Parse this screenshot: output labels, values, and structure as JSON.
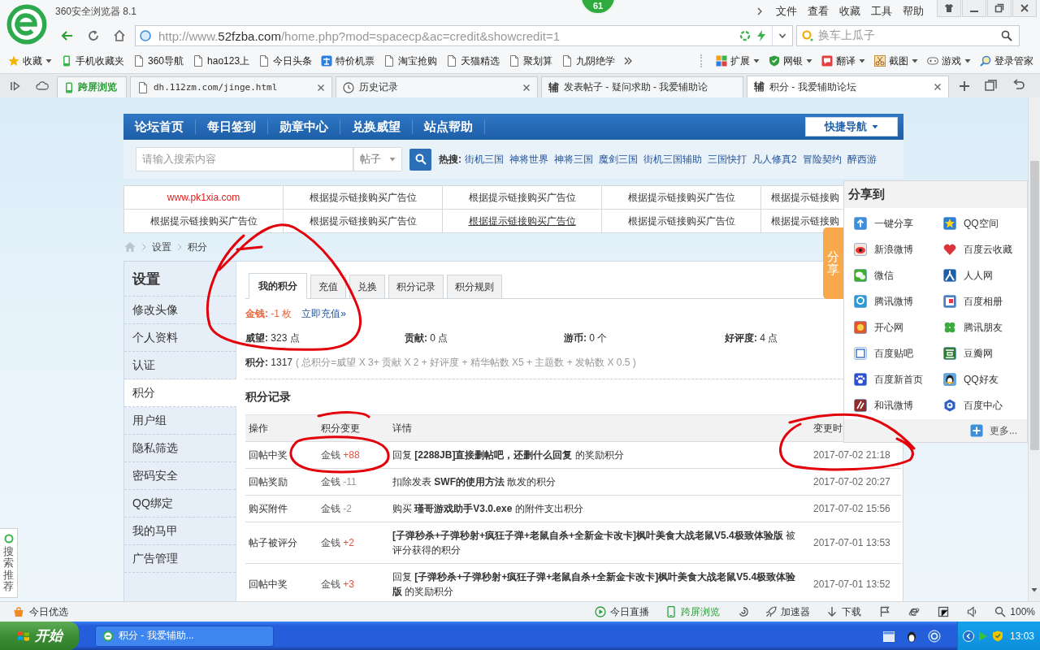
{
  "window": {
    "title": "360安全浏览器 8.1",
    "badge": "61",
    "menu": [
      "文件",
      "查看",
      "收藏",
      "工具",
      "帮助"
    ]
  },
  "address_bar": {
    "url_start": "http://www.",
    "url_domain": "52fzba.com",
    "url_rest": "/home.php?mod=spacecp&ac=credit&showcredit=1"
  },
  "search_box": {
    "placeholder": "换车上瓜子"
  },
  "bookmarks": [
    {
      "label": "收藏",
      "kind": "star",
      "dropdown": true
    },
    {
      "label": "手机收藏夹",
      "kind": "phone",
      "dropdown": false
    },
    {
      "label": "360导航",
      "kind": "page",
      "dropdown": false
    },
    {
      "label": "hao123上",
      "kind": "page",
      "dropdown": false
    },
    {
      "label": "今日头条",
      "kind": "page",
      "dropdown": false
    },
    {
      "label": "特价机票",
      "kind": "ticket",
      "dropdown": false
    },
    {
      "label": "淘宝抢购",
      "kind": "page",
      "dropdown": false
    },
    {
      "label": "天猫精选",
      "kind": "page",
      "dropdown": false
    },
    {
      "label": "聚划算",
      "kind": "page",
      "dropdown": false
    },
    {
      "label": "九阴绝学",
      "kind": "page",
      "dropdown": false
    }
  ],
  "toolbar_items": [
    {
      "label": "扩展",
      "kind": "grid",
      "dropdown": true
    },
    {
      "label": "网银",
      "kind": "shield",
      "dropdown": true
    },
    {
      "label": "翻译",
      "kind": "translate",
      "dropdown": true
    },
    {
      "label": "截图",
      "kind": "scissors",
      "dropdown": true
    },
    {
      "label": "游戏",
      "kind": "gamepad",
      "dropdown": true
    },
    {
      "label": "登录管家",
      "kind": "key",
      "dropdown": false
    }
  ],
  "tabs": [
    {
      "label": "跨屏浏览",
      "kind": "phone",
      "selected": false,
      "closable": false
    },
    {
      "label": "dh.112zm.com/jinge.html",
      "kind": "page",
      "selected": false,
      "closable": true
    },
    {
      "label": "历史记录",
      "kind": "clock",
      "selected": false,
      "closable": true
    },
    {
      "label": "发表帖子 - 疑问求助 - 我爱辅助论",
      "kind": "site",
      "favicon": "辅",
      "selected": false,
      "closable": false
    },
    {
      "label": "积分 - 我爱辅助论坛",
      "kind": "site",
      "favicon": "辅",
      "selected": true,
      "closable": true
    }
  ],
  "nav": {
    "items": [
      "论坛首页",
      "每日签到",
      "勋章中心",
      "兑换威望",
      "站点帮助"
    ],
    "quick_nav": "快捷导航"
  },
  "forum_search": {
    "placeholder": "请输入搜索内容",
    "scope": "帖子",
    "hot_label": "热搜:",
    "hot": [
      "街机三国",
      "神将世界",
      "神将三国",
      "魔剑三国",
      "街机三国辅助",
      "三国快打",
      "凡人修真2",
      "冒险契约",
      "醉西游"
    ]
  },
  "ads": [
    [
      {
        "text": "www.pk1xia.com",
        "kind": "link",
        "hovered": false
      },
      {
        "text": "根据提示链接购买广告位",
        "kind": "text",
        "hovered": false
      },
      {
        "text": "根据提示链接购买广告位",
        "kind": "text",
        "hovered": false
      },
      {
        "text": "根据提示链接购买广告位",
        "kind": "text",
        "hovered": false
      },
      {
        "text": "根据提示链接购",
        "kind": "text",
        "hovered": false
      }
    ],
    [
      {
        "text": "根据提示链接购买广告位",
        "kind": "text",
        "hovered": false
      },
      {
        "text": "根据提示链接购买广告位",
        "kind": "text",
        "hovered": false
      },
      {
        "text": "根据提示链接购买广告位",
        "kind": "text",
        "hovered": true
      },
      {
        "text": "根据提示链接购买广告位",
        "kind": "text",
        "hovered": false
      },
      {
        "text": "根据提示链接购",
        "kind": "text",
        "hovered": false
      }
    ]
  ],
  "breadcrumb": [
    "设置",
    "积分"
  ],
  "sidebar": {
    "title": "设置",
    "items": [
      {
        "label": "修改头像",
        "selected": false
      },
      {
        "label": "个人资料",
        "selected": false
      },
      {
        "label": "认证",
        "selected": false
      },
      {
        "label": "积分",
        "selected": true
      },
      {
        "label": "用户组",
        "selected": false
      },
      {
        "label": "隐私筛选",
        "selected": false
      },
      {
        "label": "密码安全",
        "selected": false
      },
      {
        "label": "QQ绑定",
        "selected": false
      },
      {
        "label": "我的马甲",
        "selected": false
      },
      {
        "label": "广告管理",
        "selected": false
      }
    ]
  },
  "credit_tabs": [
    {
      "label": "我的积分",
      "selected": true
    },
    {
      "label": "充值",
      "selected": false
    },
    {
      "label": "兑换",
      "selected": false
    },
    {
      "label": "积分记录",
      "selected": false
    },
    {
      "label": "积分规则",
      "selected": false
    }
  ],
  "money": {
    "text": "**金钱:** -1 枚",
    "recharge_link": "立即充值»"
  },
  "stats": [
    "**威望:** 323 点",
    "**贡献:** 0 点",
    "**游币:** 0 个",
    "**好评度:** 4 点"
  ],
  "total": {
    "text": "**积分:** 1317",
    "formula": "( 总积分=威望 X 3+ 贡献 X 2 + 好评度 + 精华帖数 X5 + 主题数 + 发帖数 X 0.5 )"
  },
  "log": {
    "title": "积分记录",
    "columns": [
      "操作",
      "积分变更",
      "详情",
      "变更时"
    ],
    "rows": [
      {
        "action": "回帖中奖",
        "unit": "金钱",
        "amount": "+88",
        "color": "#e0533d",
        "detail": "回复 **[2288JB]直接删帖吧，还删什么回复** 的奖励积分",
        "time": "2017-07-02 21:18"
      },
      {
        "action": "回帖奖励",
        "unit": "金钱",
        "amount": "-11",
        "color": "#999999",
        "detail": "扣除发表 **SWF的使用方法** 散发的积分",
        "time": "2017-07-02 20:27"
      },
      {
        "action": "购买附件",
        "unit": "金钱",
        "amount": "-2",
        "color": "#999999",
        "detail": "购买 **瑾哥游戏助手V3.0.exe** 的附件支出积分",
        "time": "2017-07-02 15:56"
      },
      {
        "action": "帖子被评分",
        "unit": "金钱",
        "amount": "+2",
        "color": "#e0533d",
        "detail": "**[子弹秒杀+子弹秒射+疯狂子弹+老鼠自杀+全新金卡改卡]枫叶美食大战老鼠V5.4极致体验版** 被评分获得的积分",
        "time": "2017-07-01 13:53"
      },
      {
        "action": "回帖中奖",
        "unit": "金钱",
        "amount": "+3",
        "color": "#e0533d",
        "detail": "回复 **[子弹秒杀+子弹秒射+疯狂子弹+老鼠自杀+全新金卡改卡]枫叶美食大战老鼠V5.4极致体验版** 的奖励积分",
        "time": "2017-07-01 13:52"
      }
    ]
  },
  "share": {
    "tab": "分享",
    "title": "分享到",
    "items": [
      "一键分享",
      "QQ空间",
      "新浪微博",
      "百度云收藏",
      "微信",
      "人人网",
      "腾讯微博",
      "百度相册",
      "开心网",
      "腾讯朋友",
      "百度贴吧",
      "豆瓣网",
      "百度新首页",
      "QQ好友",
      "和讯微博",
      "百度中心"
    ],
    "more": "更多..."
  },
  "side_tab": "搜索推荐",
  "status_bar": {
    "left": "今日优选",
    "items": [
      {
        "label": "今日直播",
        "kind": "play"
      },
      {
        "label": "跨屏浏览",
        "kind": "phone"
      },
      {
        "label": "加速器",
        "kind": "rocket"
      },
      {
        "label": "下载",
        "kind": "download"
      }
    ],
    "zoom": "100%"
  },
  "taskbar": {
    "start": "开始",
    "tasks": [
      {
        "label": "积分 - 我爱辅助...",
        "selected": false
      }
    ],
    "clock": "13:03"
  }
}
